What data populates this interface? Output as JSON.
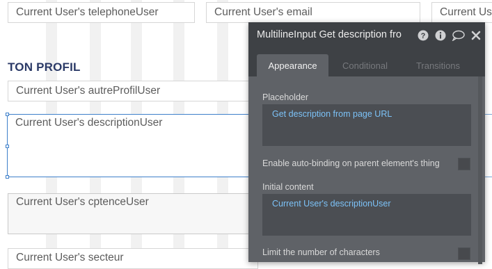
{
  "canvas": {
    "section_title": "TON PROFIL",
    "fields": {
      "telephone": "Current User's telephoneUser",
      "email": "Current User's email",
      "third": "Current Use",
      "autre_profil": "Current User's autreProfilUser",
      "description": "Current User's descriptionUser",
      "competence": "Current User's cptenceUser",
      "secteur": "Current User's secteur"
    }
  },
  "panel": {
    "title": "MultilineInput Get description fro",
    "icons": [
      "help-icon",
      "info-icon",
      "comment-icon",
      "close-icon"
    ],
    "tabs": [
      {
        "label": "Appearance",
        "active": true
      },
      {
        "label": "Conditional",
        "active": false
      },
      {
        "label": "Transitions",
        "active": false
      }
    ],
    "placeholder_label": "Placeholder",
    "placeholder_value": "Get description from page URL",
    "auto_binding_label": "Enable auto-binding on parent element's thing",
    "initial_content_label": "Initial content",
    "initial_content_value": "Current User's descriptionUser",
    "limit_chars_label": "Limit the number of characters"
  },
  "colors": {
    "panel_bg": "#5f6267",
    "panel_header": "#3e4145",
    "dynamic_text": "#7cc2f7",
    "selection": "#3d7fca",
    "section_title": "#2b3a67"
  }
}
